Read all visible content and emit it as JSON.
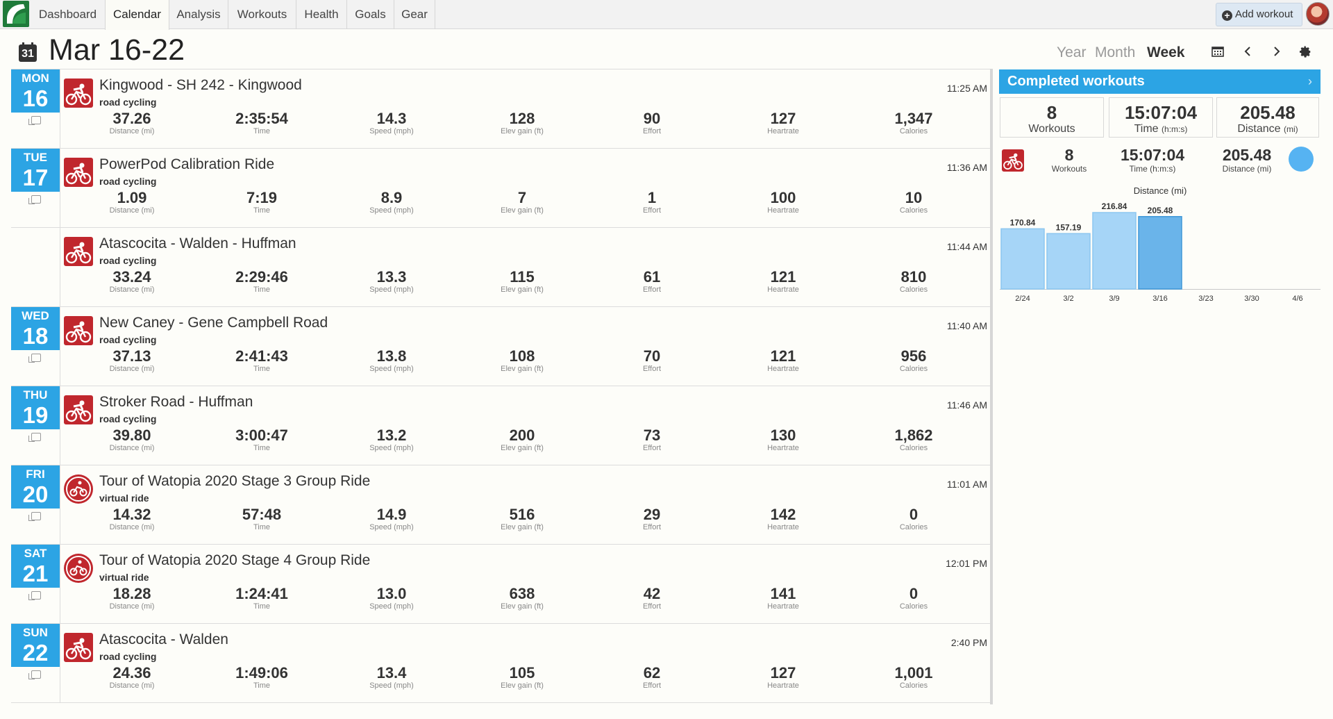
{
  "nav": {
    "tabs": [
      {
        "label": "Dashboard"
      },
      {
        "label": "Calendar"
      },
      {
        "label": "Analysis"
      },
      {
        "label": "Workouts"
      },
      {
        "label": "Health"
      },
      {
        "label": "Goals"
      },
      {
        "label": "Gear"
      }
    ],
    "active_tab": "Calendar",
    "add_workout": "Add workout"
  },
  "header": {
    "calendar_day": "31",
    "title": "Mar 16-22",
    "views": [
      "Year",
      "Month",
      "Week"
    ],
    "active_view": "Week"
  },
  "labels": {
    "distance": "Distance (mi)",
    "time": "Time",
    "speed": "Speed (mph)",
    "elev": "Elev gain (ft)",
    "effort": "Effort",
    "heartrate": "Heartrate",
    "calories": "Calories"
  },
  "workouts": [
    {
      "dow": "MON",
      "day": "16",
      "title": "Kingwood - SH 242 - Kingwood",
      "type": "road cycling",
      "time_of_day": "11:25 AM",
      "distance": "37.26",
      "time": "2:35:54",
      "speed": "14.3",
      "elev": "128",
      "effort": "90",
      "heartrate": "127",
      "calories": "1,347"
    },
    {
      "dow": "TUE",
      "day": "17",
      "title": "PowerPod Calibration Ride",
      "type": "road cycling",
      "time_of_day": "11:36 AM",
      "distance": "1.09",
      "time": "7:19",
      "speed": "8.9",
      "elev": "7",
      "effort": "1",
      "heartrate": "100",
      "calories": "10"
    },
    {
      "dow": "",
      "day": "",
      "title": "Atascocita - Walden - Huffman",
      "type": "road cycling",
      "time_of_day": "11:44 AM",
      "distance": "33.24",
      "time": "2:29:46",
      "speed": "13.3",
      "elev": "115",
      "effort": "61",
      "heartrate": "121",
      "calories": "810"
    },
    {
      "dow": "WED",
      "day": "18",
      "title": "New Caney - Gene Campbell Road",
      "type": "road cycling",
      "time_of_day": "11:40 AM",
      "distance": "37.13",
      "time": "2:41:43",
      "speed": "13.8",
      "elev": "108",
      "effort": "70",
      "heartrate": "121",
      "calories": "956"
    },
    {
      "dow": "THU",
      "day": "19",
      "title": "Stroker Road - Huffman",
      "type": "road cycling",
      "time_of_day": "11:46 AM",
      "distance": "39.80",
      "time": "3:00:47",
      "speed": "13.2",
      "elev": "200",
      "effort": "73",
      "heartrate": "130",
      "calories": "1,862"
    },
    {
      "dow": "FRI",
      "day": "20",
      "title": "Tour of Watopia 2020 Stage 3 Group Ride",
      "type": "virtual ride",
      "time_of_day": "11:01 AM",
      "distance": "14.32",
      "time": "57:48",
      "speed": "14.9",
      "elev": "516",
      "effort": "29",
      "heartrate": "142",
      "calories": "0"
    },
    {
      "dow": "SAT",
      "day": "21",
      "title": "Tour of Watopia 2020 Stage 4 Group Ride",
      "type": "virtual ride",
      "time_of_day": "12:01 PM",
      "distance": "18.28",
      "time": "1:24:41",
      "speed": "13.0",
      "elev": "638",
      "effort": "42",
      "heartrate": "141",
      "calories": "0"
    },
    {
      "dow": "SUN",
      "day": "22",
      "title": "Atascocita - Walden",
      "type": "road cycling",
      "time_of_day": "2:40 PM",
      "distance": "24.36",
      "time": "1:49:06",
      "speed": "13.4",
      "elev": "105",
      "effort": "62",
      "heartrate": "127",
      "calories": "1,001"
    }
  ],
  "panel": {
    "title": "Completed workouts",
    "summary": {
      "workouts": "8",
      "workouts_label": "Workouts",
      "time": "15:07:04",
      "time_label": "Time",
      "time_unit": "(h:m:s)",
      "distance": "205.48",
      "distance_label": "Distance",
      "distance_unit": "(mi)"
    },
    "sport": {
      "workouts": "8",
      "workouts_label": "Workouts",
      "time": "15:07:04",
      "time_label": "Time (h:m:s)",
      "distance": "205.48",
      "distance_label": "Distance (mi)"
    },
    "colors": {
      "accent": "#2ca4e4",
      "sport": "#c0272d",
      "bar": "#a6d5f7",
      "bar_current": "#6ab4ea"
    }
  },
  "chart_data": {
    "type": "bar",
    "title": "Distance (mi)",
    "categories": [
      "2/24",
      "3/2",
      "3/9",
      "3/16",
      "3/23",
      "3/30",
      "4/6"
    ],
    "values": [
      170.84,
      157.19,
      216.84,
      205.48,
      null,
      null,
      null
    ],
    "value_labels": [
      "170.84",
      "157.19",
      "216.84",
      "205.48",
      "",
      "",
      ""
    ],
    "highlight": "3/16",
    "ylim": [
      0,
      216.84
    ]
  }
}
